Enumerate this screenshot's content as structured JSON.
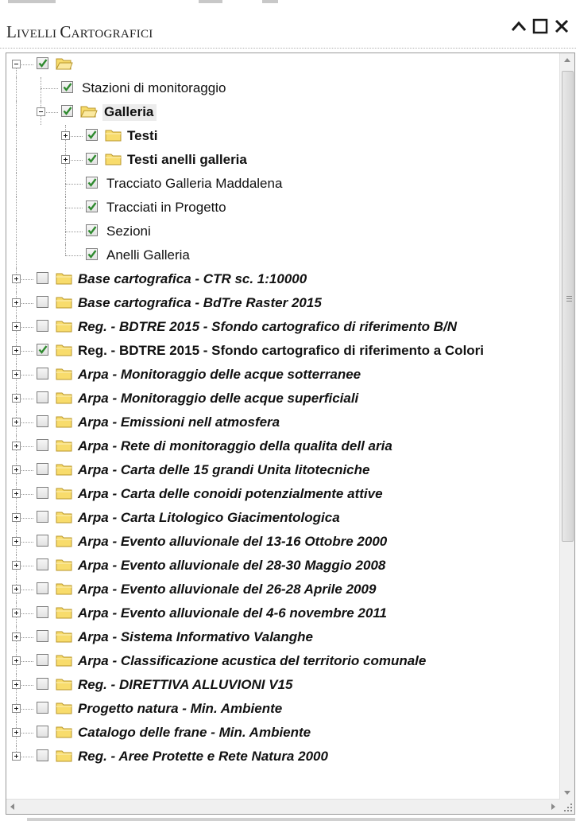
{
  "panel": {
    "title": "Livelli Cartografici",
    "title_display": {
      "l1": "L",
      "s1": "IVELLI ",
      "l2": "C",
      "s2": "ARTOGRAFICI"
    },
    "controls": [
      "collapse-icon",
      "maximize-icon",
      "close-icon"
    ]
  },
  "tree": [
    {
      "depth": 0,
      "expander": "minus",
      "checked": true,
      "folder": "open",
      "label": "",
      "style": "normal"
    },
    {
      "depth": 1,
      "expander": "none",
      "checked": true,
      "folder": "none",
      "label": "Stazioni di monitoraggio",
      "style": "normal"
    },
    {
      "depth": 1,
      "expander": "minus",
      "checked": true,
      "folder": "open",
      "label": "Galleria",
      "style": "bold-selected"
    },
    {
      "depth": 2,
      "expander": "plus",
      "checked": true,
      "folder": "closed",
      "label": "Testi",
      "style": "bold"
    },
    {
      "depth": 2,
      "expander": "plus",
      "checked": true,
      "folder": "closed",
      "label": "Testi anelli galleria",
      "style": "bold"
    },
    {
      "depth": 2,
      "expander": "none",
      "checked": true,
      "folder": "none",
      "label": "Tracciato Galleria Maddalena",
      "style": "normal"
    },
    {
      "depth": 2,
      "expander": "none",
      "checked": true,
      "folder": "none",
      "label": "Tracciati in Progetto",
      "style": "normal"
    },
    {
      "depth": 2,
      "expander": "none",
      "checked": true,
      "folder": "none",
      "label": "Sezioni",
      "style": "normal"
    },
    {
      "depth": 2,
      "expander": "none",
      "checked": true,
      "folder": "none",
      "label": "Anelli Galleria",
      "style": "normal",
      "last": true
    },
    {
      "depth": 0,
      "expander": "plus",
      "checked": false,
      "folder": "closed",
      "label": "Base cartografica - CTR sc. 1:10000",
      "style": "bold-italic"
    },
    {
      "depth": 0,
      "expander": "plus",
      "checked": false,
      "folder": "closed",
      "label": "Base cartografica - BdTre Raster 2015",
      "style": "bold-italic"
    },
    {
      "depth": 0,
      "expander": "plus",
      "checked": false,
      "folder": "closed",
      "label": "Reg. - BDTRE 2015 - Sfondo cartografico di riferimento B/N",
      "style": "bold-italic"
    },
    {
      "depth": 0,
      "expander": "plus",
      "checked": true,
      "folder": "closed",
      "label": "Reg. - BDTRE 2015 - Sfondo cartografico di riferimento a Colori",
      "style": "bold"
    },
    {
      "depth": 0,
      "expander": "plus",
      "checked": false,
      "folder": "closed",
      "label": "Arpa - Monitoraggio delle acque sotterranee",
      "style": "bold-italic"
    },
    {
      "depth": 0,
      "expander": "plus",
      "checked": false,
      "folder": "closed",
      "label": "Arpa - Monitoraggio delle acque superficiali",
      "style": "bold-italic"
    },
    {
      "depth": 0,
      "expander": "plus",
      "checked": false,
      "folder": "closed",
      "label": "Arpa - Emissioni nell atmosfera",
      "style": "bold-italic"
    },
    {
      "depth": 0,
      "expander": "plus",
      "checked": false,
      "folder": "closed",
      "label": "Arpa - Rete di monitoraggio della qualita dell aria",
      "style": "bold-italic"
    },
    {
      "depth": 0,
      "expander": "plus",
      "checked": false,
      "folder": "closed",
      "label": "Arpa - Carta delle 15 grandi Unita litotecniche",
      "style": "bold-italic"
    },
    {
      "depth": 0,
      "expander": "plus",
      "checked": false,
      "folder": "closed",
      "label": "Arpa - Carta delle conoidi potenzialmente attive",
      "style": "bold-italic"
    },
    {
      "depth": 0,
      "expander": "plus",
      "checked": false,
      "folder": "closed",
      "label": "Arpa - Carta Litologico Giacimentologica",
      "style": "bold-italic"
    },
    {
      "depth": 0,
      "expander": "plus",
      "checked": false,
      "folder": "closed",
      "label": "Arpa - Evento alluvionale del 13-16 Ottobre 2000",
      "style": "bold-italic"
    },
    {
      "depth": 0,
      "expander": "plus",
      "checked": false,
      "folder": "closed",
      "label": "Arpa - Evento alluvionale del 28-30 Maggio 2008",
      "style": "bold-italic"
    },
    {
      "depth": 0,
      "expander": "plus",
      "checked": false,
      "folder": "closed",
      "label": "Arpa - Evento alluvionale del 26-28 Aprile 2009",
      "style": "bold-italic"
    },
    {
      "depth": 0,
      "expander": "plus",
      "checked": false,
      "folder": "closed",
      "label": "Arpa - Evento alluvionale del 4-6 novembre 2011",
      "style": "bold-italic"
    },
    {
      "depth": 0,
      "expander": "plus",
      "checked": false,
      "folder": "closed",
      "label": "Arpa - Sistema Informativo Valanghe",
      "style": "bold-italic"
    },
    {
      "depth": 0,
      "expander": "plus",
      "checked": false,
      "folder": "closed",
      "label": "Arpa - Classificazione acustica del territorio comunale",
      "style": "bold-italic"
    },
    {
      "depth": 0,
      "expander": "plus",
      "checked": false,
      "folder": "closed",
      "label": "Reg. - DIRETTIVA ALLUVIONI V15",
      "style": "bold-italic"
    },
    {
      "depth": 0,
      "expander": "plus",
      "checked": false,
      "folder": "closed",
      "label": "Progetto natura - Min. Ambiente",
      "style": "bold-italic"
    },
    {
      "depth": 0,
      "expander": "plus",
      "checked": false,
      "folder": "closed",
      "label": "Catalogo delle frane - Min. Ambiente",
      "style": "bold-italic"
    },
    {
      "depth": 0,
      "expander": "plus",
      "checked": false,
      "folder": "closed",
      "label": "Reg. - Aree Protette e Rete Natura 2000",
      "style": "bold-italic"
    }
  ],
  "colors": {
    "checkmark": "#2f8a2f",
    "folder_fill": "#f8dc6c",
    "folder_stroke": "#b8962a",
    "selection_bg": "#ececec",
    "tree_lines": "#9a9a9a"
  }
}
